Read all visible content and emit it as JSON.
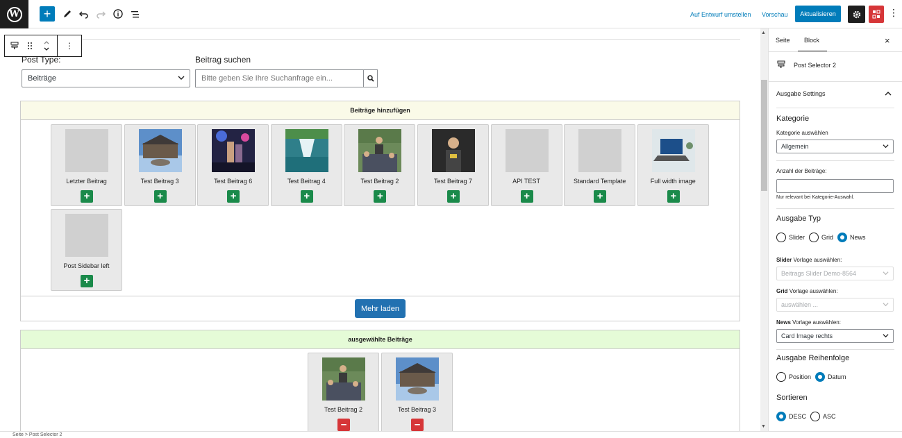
{
  "topbar": {
    "logo": "W",
    "add_icon": "+",
    "links": {
      "draft": "Auf Entwurf umstellen",
      "preview": "Vorschau"
    },
    "update_label": "Aktualisieren"
  },
  "block_toolbar": {
    "icon": "post-selector-icon"
  },
  "form": {
    "post_type_label": "Post Type:",
    "post_type_value": "Beiträge",
    "search_label": "Beitrag suchen",
    "search_placeholder": "Bitte geben Sie Ihre Suchanfrage ein..."
  },
  "add_panel": {
    "title": "Beiträge hinzufügen",
    "cards": [
      {
        "title": "Letzter Beitrag",
        "thumb": "none"
      },
      {
        "title": "Test Beitrag 3",
        "thumb": "building"
      },
      {
        "title": "Test Beitrag 6",
        "thumb": "concert"
      },
      {
        "title": "Test Beitrag 4",
        "thumb": "waterfall"
      },
      {
        "title": "Test Beitrag 2",
        "thumb": "crowd"
      },
      {
        "title": "Test Beitrag 7",
        "thumb": "person"
      },
      {
        "title": "API TEST",
        "thumb": "none"
      },
      {
        "title": "Standard Template",
        "thumb": "none"
      },
      {
        "title": "Full width image",
        "thumb": "laptop"
      },
      {
        "title": "Post Sidebar left",
        "thumb": "none"
      }
    ],
    "more_label": "Mehr laden"
  },
  "selected_panel": {
    "title": "ausgewählte Beiträge",
    "cards": [
      {
        "title": "Test Beitrag 2",
        "thumb": "crowd"
      },
      {
        "title": "Test Beitrag 3",
        "thumb": "building"
      }
    ]
  },
  "sidebar": {
    "tabs": [
      "Seite",
      "Block"
    ],
    "block_name": "Post Selector 2",
    "section_title": "Ausgabe Settings",
    "kategorie_heading": "Kategorie",
    "kategorie_label": "Kategorie auswählen",
    "kategorie_value": "Allgemein",
    "anzahl_label": "Anzahl der Beiträge:",
    "anzahl_help": "Nur relevant bei Kategorie-Auswahl.",
    "typ_heading": "Ausgabe Typ",
    "typ_options": [
      "Slider",
      "Grid",
      "News"
    ],
    "typ_selected": "News",
    "slider_bold": "Slider",
    "slider_label": "Vorlage auswählen:",
    "slider_value": "Beitrags Slider Demo-8564",
    "grid_bold": "Grid",
    "grid_label": "Vorlage auswählen:",
    "grid_value": "auswählen ...",
    "news_bold": "News",
    "news_label": "Vorlage auswählen:",
    "news_value": "Card Image rechts",
    "order_heading": "Ausgabe Reihenfolge",
    "order_options": [
      "Position",
      "Datum"
    ],
    "order_selected": "Datum",
    "sort_heading": "Sortieren",
    "sort_options": [
      "DESC",
      "ASC"
    ],
    "sort_selected": "DESC"
  },
  "footer": {
    "breadcrumb": "Seite  >  Post Selector 2"
  }
}
